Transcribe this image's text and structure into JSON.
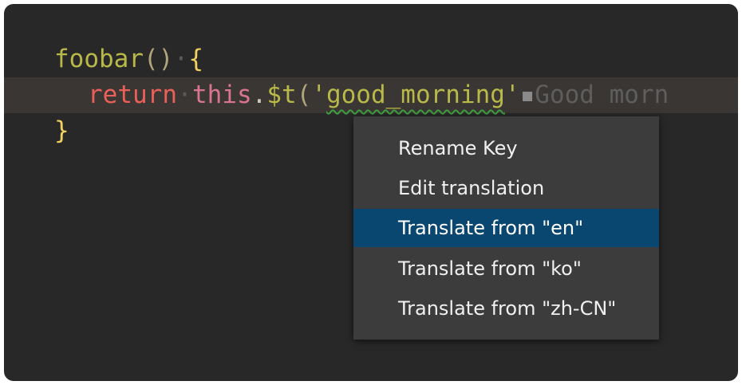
{
  "editor": {
    "line1": {
      "fn": "foobar",
      "parens": "()",
      "ws": "·",
      "brace": "{"
    },
    "line2": {
      "keyword": "return",
      "ws": "·",
      "this": "this",
      "dot": ".",
      "method": "$t",
      "open_paren": "(",
      "quote_open": "'",
      "string": "good_morning",
      "quote_close": "'",
      "separator": "▪",
      "inline_hint": "Good morn"
    },
    "line3": {
      "brace": "}"
    }
  },
  "context_menu": {
    "items": [
      {
        "label": "Rename Key"
      },
      {
        "label": "Edit translation"
      },
      {
        "label": "Translate from \"en\""
      },
      {
        "label": "Translate from \"ko\""
      },
      {
        "label": "Translate from \"zh-CN\""
      }
    ],
    "selected_index": 2
  },
  "colors": {
    "editor_background": "#282828",
    "current_line": "#3a3633",
    "menu_background": "#3c3c3c",
    "menu_selected": "#094771",
    "squiggle": "#3f9f3f"
  }
}
